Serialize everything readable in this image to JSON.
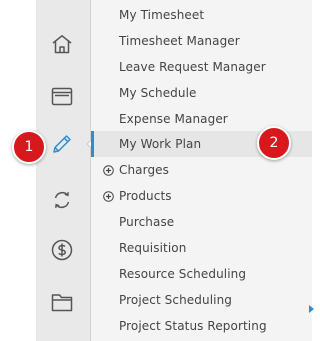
{
  "rail": {
    "icons": [
      {
        "name": "home-icon"
      },
      {
        "name": "window-icon"
      },
      {
        "name": "pencil-icon"
      },
      {
        "name": "sync-icon"
      },
      {
        "name": "dollar-icon"
      },
      {
        "name": "folder-icon"
      }
    ]
  },
  "menu": {
    "items": [
      {
        "label": "My Timesheet"
      },
      {
        "label": "Timesheet Manager"
      },
      {
        "label": "Leave Request Manager"
      },
      {
        "label": "My Schedule"
      },
      {
        "label": "Expense Manager"
      },
      {
        "label": "My Work Plan",
        "active": true
      },
      {
        "label": "Charges",
        "expandable": true
      },
      {
        "label": "Products",
        "expandable": true
      },
      {
        "label": "Purchase"
      },
      {
        "label": "Requisition"
      },
      {
        "label": "Resource Scheduling"
      },
      {
        "label": "Project Scheduling"
      },
      {
        "label": "Project Status Reporting"
      }
    ]
  },
  "callouts": [
    {
      "label": "1"
    },
    {
      "label": "2"
    }
  ],
  "colors": {
    "accent": "#2f8ecf",
    "callout": "#d7191d",
    "rail_bg": "#e9e9e9",
    "menu_bg": "#f4f4f4",
    "active_bg": "#e6e6e6"
  }
}
